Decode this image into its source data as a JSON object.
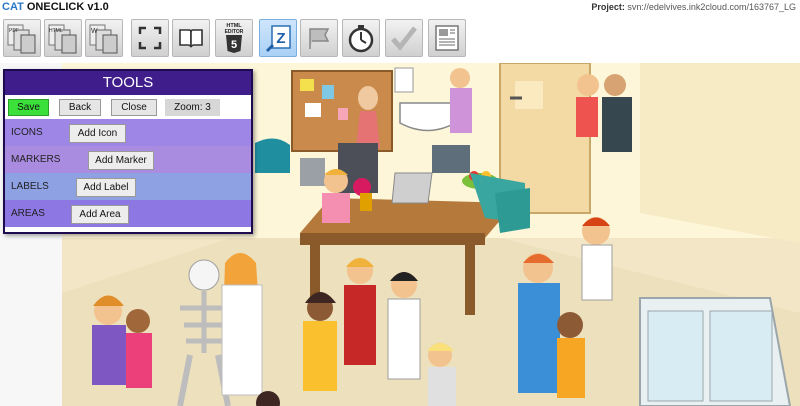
{
  "app": {
    "title_prefix": "CAT",
    "title_rest": " ONECLICK v1.0"
  },
  "project": {
    "label": "Project:",
    "value": "svn://edelvives.ink2cloud.com/163767_LG"
  },
  "toolbar": {
    "buttons": [
      {
        "name": "pdf-export-button",
        "icon": "pdf-doc-icon",
        "caption": "PDF"
      },
      {
        "name": "html-export-button",
        "icon": "html-doc-icon",
        "caption": "HTML"
      },
      {
        "name": "word-export-button",
        "icon": "word-doc-icon",
        "caption": "W"
      },
      {
        "name": "fullscreen-button",
        "icon": "fullscreen-icon"
      },
      {
        "name": "book-button",
        "icon": "book-icon"
      },
      {
        "name": "html5-editor-button",
        "icon": "html5-editor-icon",
        "caption1": "HTML",
        "caption2": "EDITOR",
        "caption3": "5"
      },
      {
        "name": "zoom-tool-button",
        "icon": "zoom-editor-icon",
        "caption": "Z"
      },
      {
        "name": "flag-button",
        "icon": "flag-icon"
      },
      {
        "name": "timer-button",
        "icon": "stopwatch-icon"
      },
      {
        "name": "check-button",
        "icon": "checkmark-icon"
      },
      {
        "name": "layout-button",
        "icon": "document-layout-icon"
      }
    ]
  },
  "tools": {
    "title": "TOOLS",
    "save": "Save",
    "back": "Back",
    "close": "Close",
    "zoom": "Zoom: 3",
    "rows": [
      {
        "label": "ICONS",
        "button": "Add Icon",
        "color": "#9d86e6"
      },
      {
        "label": "MARKERS",
        "button": "Add Marker",
        "color": "#a98be0"
      },
      {
        "label": "LABELS",
        "button": "Add Label",
        "color": "#8ea1e3"
      },
      {
        "label": "AREAS",
        "button": "Add Area",
        "color": "#8c77e3"
      }
    ]
  }
}
